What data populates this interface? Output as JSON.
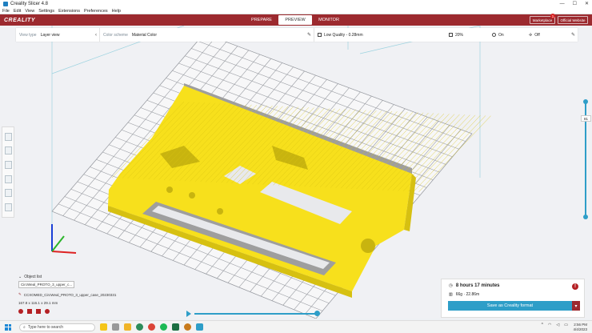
{
  "window": {
    "title": "Creality Slicer 4.8",
    "controls": [
      "—",
      "☐",
      "✕"
    ]
  },
  "menu": [
    "File",
    "Edit",
    "View",
    "Settings",
    "Extensions",
    "Preferences",
    "Help"
  ],
  "header": {
    "logo": "CREALITY",
    "tabs": [
      {
        "label": "PREPARE",
        "active": false
      },
      {
        "label": "PREVIEW",
        "active": true
      },
      {
        "label": "MONITOR",
        "active": false
      }
    ],
    "marketplace_label": "Marketplace",
    "marketplace_badge": "1",
    "official_website_label": "Official Website",
    "accent_color": "#9c2a2f"
  },
  "toolbar": {
    "view_type_label": "View type",
    "view_type_value": "Layer view",
    "color_scheme_label": "Color scheme",
    "color_scheme_value": "Material Color",
    "quality_value": "Low Quality - 0.28mm",
    "infill_value": "20%",
    "support_value": "On",
    "adhesion_value": "Off"
  },
  "left_tools": [
    "move-tool-icon",
    "scale-tool-icon",
    "rotate-tool-icon",
    "mirror-tool-icon",
    "per-model-settings-icon",
    "support-blocker-icon"
  ],
  "layer_slider": {
    "current_layer": "81"
  },
  "object_list": {
    "title": "Object list",
    "selected_object": "CircWeal_PROTO_3_upper_c...",
    "file_name": "CCXOMED_CircWeal_PROTO_3_upper_case_20230331",
    "dimensions": "167.8 x 116.1 x 29.1 mm"
  },
  "print_info": {
    "time": "8 hours 17 minutes",
    "material": "66g · 22.86m",
    "save_label": "Save as Creality format",
    "alert_icon": "!"
  },
  "taskbar": {
    "search_placeholder": "Type here to search",
    "apps": [
      "copilot-icon",
      "file-explorer-icon",
      "edge-icon",
      "chrome-icon",
      "spotify-icon",
      "excel-icon",
      "slicer-icon",
      "creality-icon"
    ],
    "time": "2:56 PM",
    "date": "4/4/2023"
  },
  "model_color": "#f7e01c"
}
